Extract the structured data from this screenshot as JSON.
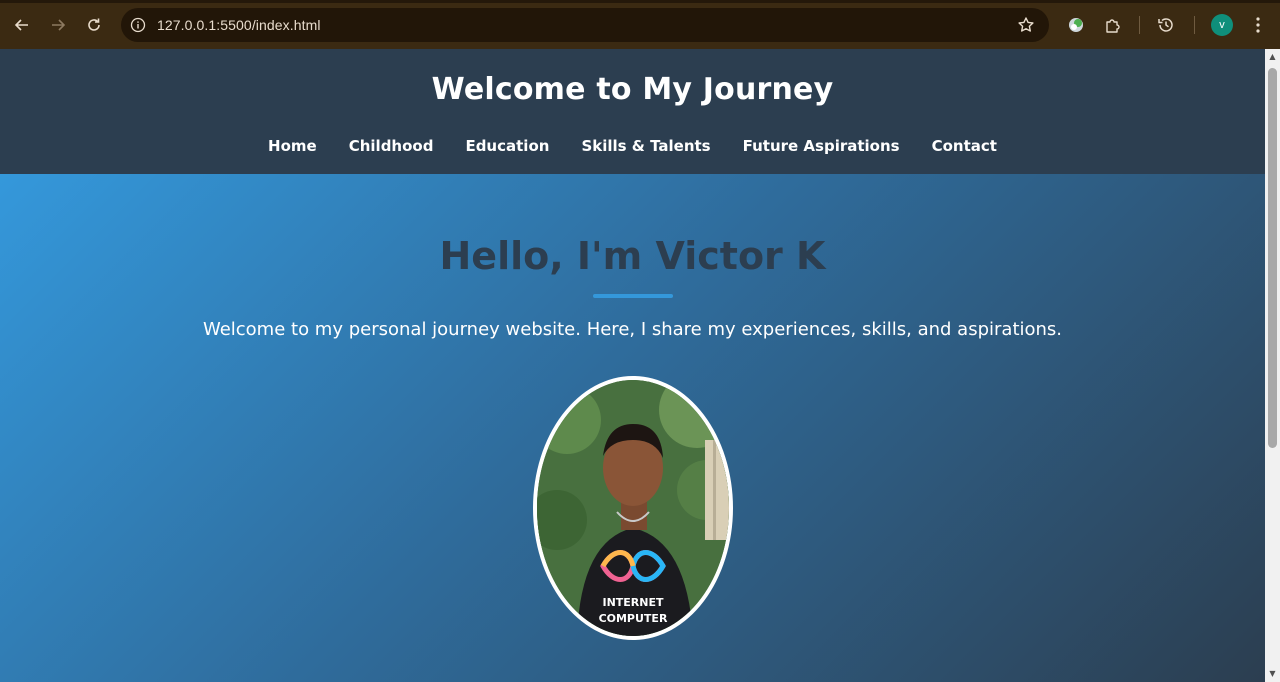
{
  "browser": {
    "url": "127.0.0.1:5500/index.html",
    "profile_initial": "v",
    "icons": {
      "back": "back-arrow-icon",
      "forward": "forward-arrow-icon",
      "reload": "reload-icon",
      "site_info": "info-icon",
      "bookmark": "star-icon",
      "extension_1": "chrome-extension-icon",
      "extensions": "puzzle-icon",
      "history": "history-icon",
      "menu": "kebab-menu-icon"
    }
  },
  "site": {
    "title": "Welcome to My Journey",
    "nav": [
      "Home",
      "Childhood",
      "Education",
      "Skills & Talents",
      "Future Aspirations",
      "Contact"
    ]
  },
  "hero": {
    "heading": "Hello, I'm Victor K",
    "text": "Welcome to my personal journey website. Here, I share my experiences, skills, and aspirations.",
    "photo_shirt_text_line1": "INTERNET",
    "photo_shirt_text_line2": "COMPUTER"
  },
  "colors": {
    "header_bg": "#2c3e50",
    "accent": "#3498db",
    "chrome_bg": "#3b2a12"
  }
}
